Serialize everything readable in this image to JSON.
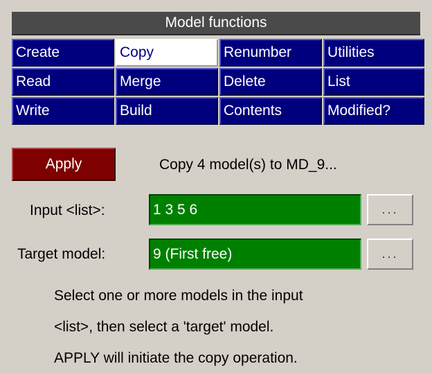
{
  "header": {
    "title": "Model functions"
  },
  "functions": [
    {
      "label": "Create"
    },
    {
      "label": "Copy"
    },
    {
      "label": "Renumber"
    },
    {
      "label": "Utilities"
    },
    {
      "label": "Read"
    },
    {
      "label": "Merge"
    },
    {
      "label": "Delete"
    },
    {
      "label": "List"
    },
    {
      "label": "Write"
    },
    {
      "label": "Build"
    },
    {
      "label": "Contents"
    },
    {
      "label": "Modified?"
    }
  ],
  "selected_function": "Copy",
  "apply": {
    "label": "Apply"
  },
  "status": "Copy 4 model(s) to MD_9...",
  "input_list": {
    "label": "Input <list>:",
    "value": "1 3 5 6",
    "browse_label": "..."
  },
  "target_model": {
    "label": "Target model:",
    "value": "9 (First free)",
    "browse_label": "..."
  },
  "help": [
    "Select one or more models in the input",
    "<list>, then select a 'target' model.",
    "APPLY will initiate the copy operation."
  ],
  "colors": {
    "panel_bg": "#d4d0c8",
    "title_bg": "#4a4a4a",
    "function_button_bg": "#00007e",
    "selected_button_bg": "#ffffff",
    "apply_bg": "#7e0000",
    "field_bg": "#008000"
  }
}
